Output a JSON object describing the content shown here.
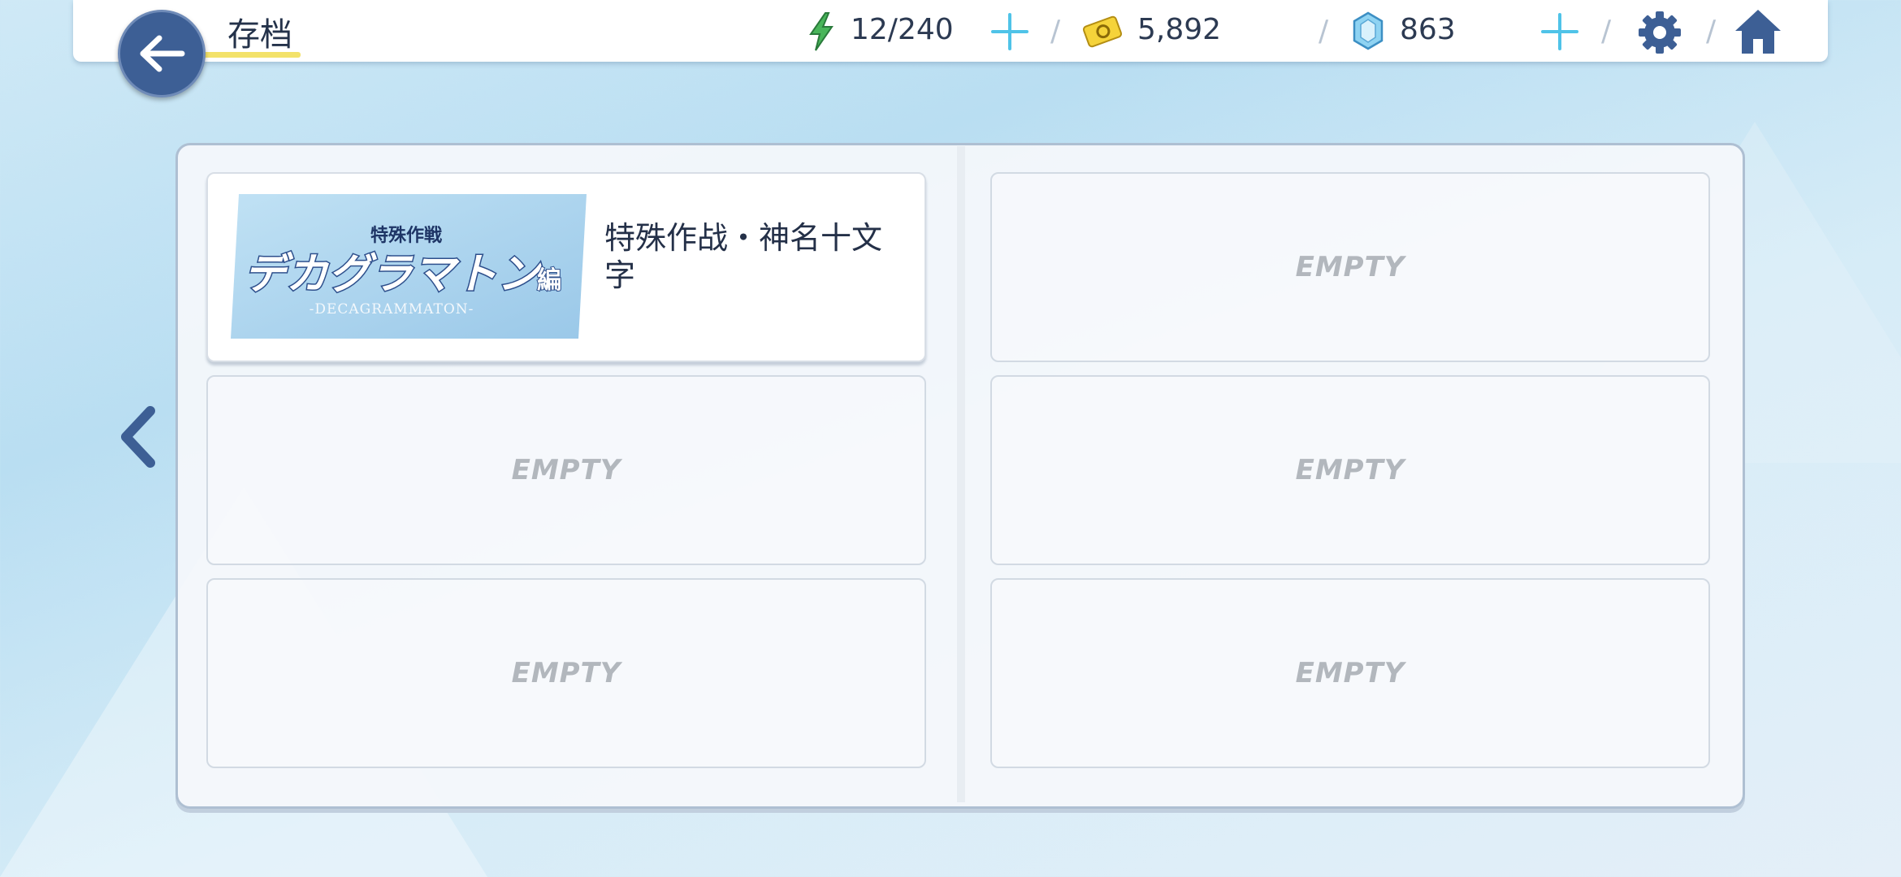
{
  "header": {
    "title": "存档",
    "stamina": "12/240",
    "credits": "5,892",
    "gems": "863",
    "separator": "/"
  },
  "icons": {
    "back": "back-arrow-icon",
    "stamina": "lightning-icon",
    "credits": "credit-card-icon",
    "gems": "crystal-gem-icon",
    "settings": "gear-icon",
    "home": "home-icon",
    "prev_page": "chevron-left-icon"
  },
  "slots": [
    {
      "title": "特殊作战・神名十文字",
      "banner": {
        "top_text": "特殊作戦",
        "main_text": "デカグラマトン",
        "tag": "編",
        "sub_text": "-DECAGRAMMATON-"
      }
    },
    {
      "label": "EMPTY"
    },
    {
      "label": "EMPTY"
    },
    {
      "label": "EMPTY"
    },
    {
      "label": "EMPTY"
    },
    {
      "label": "EMPTY"
    }
  ],
  "colors": {
    "accent_blue": "#3d5f95",
    "underline_yellow": "#f3e26a",
    "plus_cyan": "#4fc3e8",
    "empty_gray": "#b2b7bd"
  }
}
